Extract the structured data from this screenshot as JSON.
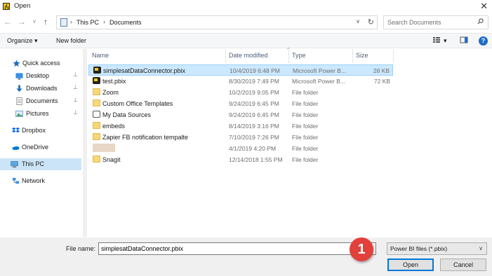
{
  "window": {
    "title": "Open",
    "close_glyph": "✕"
  },
  "nav": {
    "back": "←",
    "forward": "→",
    "dropdown": "∨",
    "up": "↑"
  },
  "address": {
    "crumbs": [
      "This PC",
      "Documents"
    ],
    "separator": "›",
    "dropdown": "∨",
    "refresh": "↻"
  },
  "search": {
    "placeholder": "Search Documents"
  },
  "toolbar": {
    "organize": "Organize",
    "organize_caret": "▾",
    "new_folder": "New folder",
    "view_caret": "▾",
    "help": "?"
  },
  "sidebar": {
    "items": [
      {
        "label": "Quick access",
        "icon": "star-icon",
        "color": "#1e6dc1"
      },
      {
        "label": "Desktop",
        "icon": "desktop-icon",
        "pinned": true
      },
      {
        "label": "Downloads",
        "icon": "download-icon",
        "pinned": true
      },
      {
        "label": "Documents",
        "icon": "documents-icon",
        "pinned": true
      },
      {
        "label": "Pictures",
        "icon": "pictures-icon",
        "pinned": true
      },
      {
        "label": "Dropbox",
        "icon": "dropbox-icon",
        "color": "#0061fe"
      },
      {
        "label": "OneDrive",
        "icon": "onedrive-icon",
        "color": "#0078d4"
      },
      {
        "label": "This PC",
        "icon": "pc-icon",
        "selected": true
      },
      {
        "label": "Network",
        "icon": "network-icon"
      }
    ],
    "pin_glyph": "📌"
  },
  "columns": {
    "name": "Name",
    "date": "Date modified",
    "type": "Type",
    "size": "Size",
    "sort_caret": "^"
  },
  "files": [
    {
      "name": "simplesatDataConnector.pbix",
      "date": "10/4/2019 6:48 PM",
      "type": "Microsoft Power B...",
      "size": "28 KB",
      "icon": "pbix",
      "selected": true
    },
    {
      "name": "test.pbix",
      "date": "8/30/2019 7:49 PM",
      "type": "Microsoft Power B...",
      "size": "72 KB",
      "icon": "pbix"
    },
    {
      "name": "Zoom",
      "date": "10/2/2019 9:05 PM",
      "type": "File folder",
      "size": "",
      "icon": "folder"
    },
    {
      "name": "Custom Office Templates",
      "date": "9/24/2019 6:45 PM",
      "type": "File folder",
      "size": "",
      "icon": "folder"
    },
    {
      "name": "My Data Sources",
      "date": "9/24/2019 6:45 PM",
      "type": "File folder",
      "size": "",
      "icon": "ds"
    },
    {
      "name": "embeds",
      "date": "8/14/2019 3:16 PM",
      "type": "File folder",
      "size": "",
      "icon": "folder"
    },
    {
      "name": "Zapier FB notification tempalte",
      "date": "7/10/2019 7:26 PM",
      "type": "File folder",
      "size": "",
      "icon": "folder"
    },
    {
      "name": "",
      "date": "4/1/2019 4:20 PM",
      "type": "File folder",
      "size": "",
      "icon": "blur"
    },
    {
      "name": "Snagit",
      "date": "12/14/2018 1:55 PM",
      "type": "File folder",
      "size": "",
      "icon": "folder"
    }
  ],
  "footer": {
    "file_name_label": "File name:",
    "file_name_value": "simplesatDataConnector.pbix",
    "file_type": "Power BI files (*.pbix)",
    "file_type_caret": "∨",
    "open": "Open",
    "cancel": "Cancel"
  },
  "annotation": {
    "step": "1",
    "color": "#e2403a"
  }
}
